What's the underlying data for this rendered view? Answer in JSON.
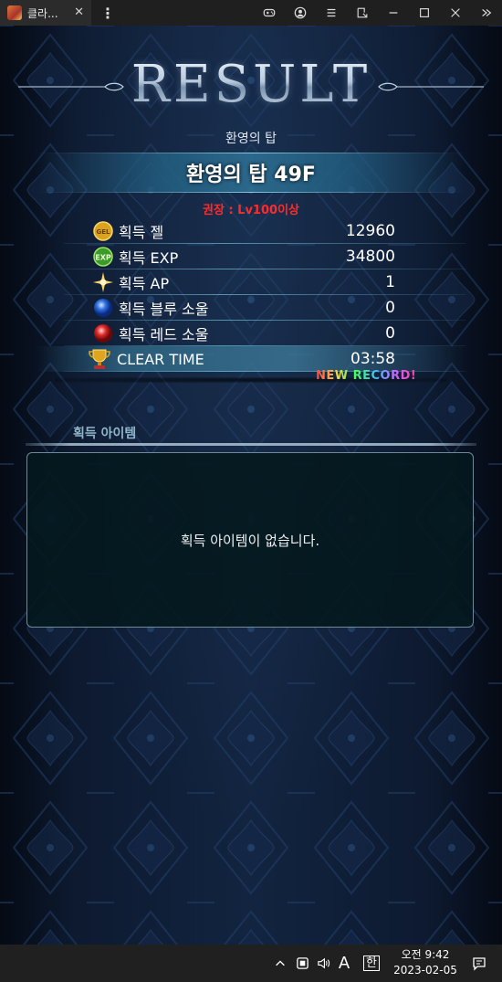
{
  "browser": {
    "tab_title": "클라...",
    "tab_close": "✕",
    "menu": "⋮",
    "icons": [
      "gamepad-icon",
      "account-icon",
      "list-icon",
      "resize-icon",
      "minimize-icon",
      "maximize-icon",
      "close-icon",
      "collapse-icon"
    ]
  },
  "result": {
    "title": "RESULT",
    "dungeon_name": "환영의 탑",
    "floor_title": "환영의 탑 49F",
    "recommend": "권장 :  Lv100이상",
    "stats": [
      {
        "icon": "gel-coin-icon",
        "label": "획득 젤",
        "value": "12960"
      },
      {
        "icon": "exp-icon",
        "label": "획득 EXP",
        "value": "34800"
      },
      {
        "icon": "ap-sparkle-icon",
        "label": "획득 AP",
        "value": "1"
      },
      {
        "icon": "blue-soul-icon",
        "label": "획득 블루 소울",
        "value": "0"
      },
      {
        "icon": "red-soul-icon",
        "label": "획득 레드 소울",
        "value": "0"
      },
      {
        "icon": "trophy-icon",
        "label": "CLEAR TIME",
        "value": "03:58"
      }
    ],
    "new_record": "NEW RECORD!"
  },
  "items": {
    "section_label": "획득 아이템",
    "empty_message": "획득 아이템이 없습니다."
  },
  "taskbar": {
    "ime_letter": "A",
    "ime_hangul": "한",
    "time": "오전 9:42",
    "date": "2023-02-05"
  },
  "colors": {
    "recommend": "#ff2a2a",
    "background": "#0b1424",
    "banner": "#2d6e91"
  }
}
